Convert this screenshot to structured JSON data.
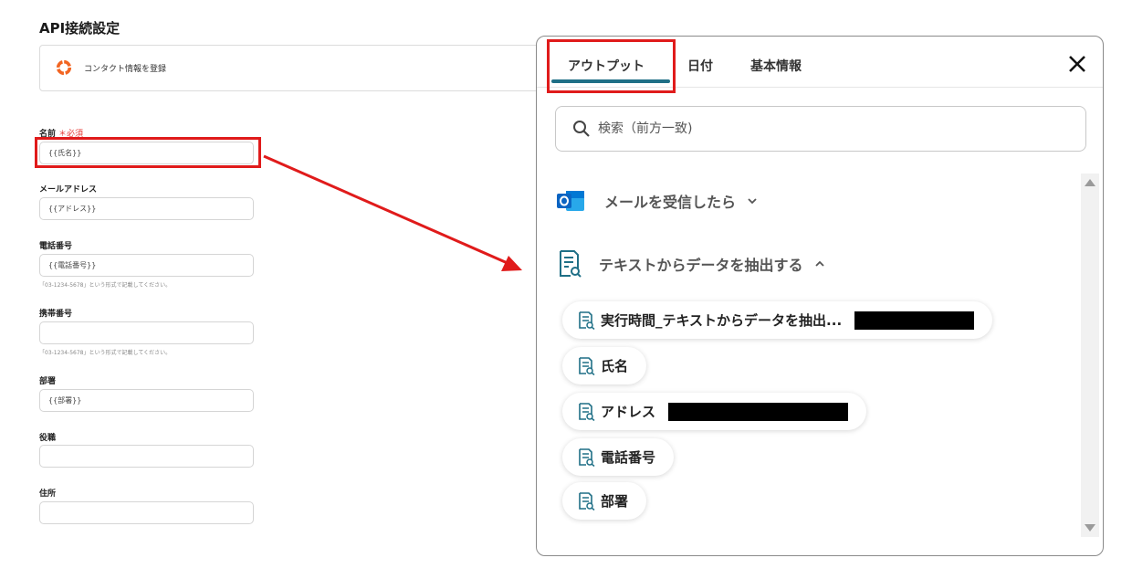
{
  "form": {
    "section_title": "API接続設定",
    "app_name": "コンタクト情報を登録",
    "fields": [
      {
        "label": "名前",
        "required": "＊必須",
        "value": "{{氏名}}"
      },
      {
        "label": "メールアドレス",
        "value": "{{アドレス}}"
      },
      {
        "label": "電話番号",
        "value": "{{電話番号}}",
        "hint": "「03-1234-5678」という形式で記載してください。"
      },
      {
        "label": "携帯番号",
        "value": "",
        "hint": "「03-1234-5678」という形式で記載してください。"
      },
      {
        "label": "部署",
        "value": "{{部署}}"
      },
      {
        "label": "役職",
        "value": ""
      },
      {
        "label": "住所",
        "value": ""
      }
    ]
  },
  "panel": {
    "tabs": [
      {
        "label": "アウトプット",
        "active": true
      },
      {
        "label": "日付"
      },
      {
        "label": "基本情報"
      }
    ],
    "search": {
      "placeholder": "検索（前方一致)"
    },
    "groups": [
      {
        "label": "メールを受信したら",
        "icon": "outlook-icon",
        "state": "collapsed"
      },
      {
        "label": "テキストからデータを抽出する",
        "icon": "document-search-icon",
        "state": "expanded"
      }
    ],
    "items": [
      {
        "label": "実行時間_テキストからデータを抽出...",
        "redacted": true
      },
      {
        "label": "氏名"
      },
      {
        "label": "アドレス",
        "redacted": true
      },
      {
        "label": "電話番号"
      },
      {
        "label": "部署"
      }
    ]
  },
  "colors": {
    "highlight": "#e01b1b",
    "tab_underline": "#1f6f86",
    "outlook_blue": "#0a64c2",
    "doc_icon": "#1f6f86"
  }
}
